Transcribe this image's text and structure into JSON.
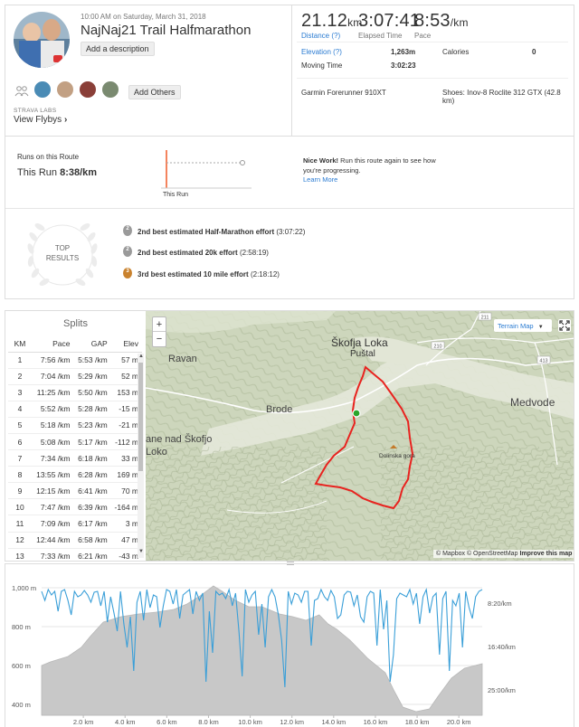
{
  "activity": {
    "datetime": "10:00 AM on Saturday, March 31, 2018",
    "title": "NajNaj21 Trail Halfmarathon",
    "add_description": "Add a description",
    "add_others": "Add Others",
    "strava_labs": "STRAVA LABS",
    "view_flybys": "View Flybys"
  },
  "stats": {
    "distance_value": "21.12",
    "distance_unit": "km",
    "distance_label": "Distance (?)",
    "elapsed_value": "3:07:41",
    "elapsed_label": "Elapsed Time",
    "pace_value": "8:53",
    "pace_unit": "/km",
    "pace_label": "Pace",
    "elevation_label": "Elevation (?)",
    "elevation_value": "1,263m",
    "calories_label": "Calories",
    "calories_value": "0",
    "moving_label": "Moving Time",
    "moving_value": "3:02:23",
    "device": "Garmin Forerunner 910XT",
    "shoes": "Shoes: Inov-8 Roclite 312 GTX (42.8 km)"
  },
  "route": {
    "heading": "Runs on this Route",
    "this_run_label": "This Run",
    "this_run_pace": "8:38/km",
    "chart_label": "This Run",
    "nice_work_bold": "Nice Work!",
    "nice_work_text": " Run this route again to see how you're progressing.",
    "learn_more": "Learn More"
  },
  "top_results": {
    "badge_line1": "TOP",
    "badge_line2": "RESULTS",
    "items": [
      {
        "rank": "2",
        "bold": "2nd best estimated Half-Marathon effort",
        "time": "(3:07:22)",
        "medal": "silver"
      },
      {
        "rank": "2",
        "bold": "2nd best estimated 20k effort",
        "time": "(2:58:19)",
        "medal": "silver"
      },
      {
        "rank": "3",
        "bold": "3rd best estimated 10 mile effort",
        "time": "(2:18:12)",
        "medal": "bronze"
      }
    ]
  },
  "splits": {
    "title": "Splits",
    "headers": [
      "KM",
      "Pace",
      "GAP",
      "Elev"
    ],
    "rows": [
      [
        "1",
        "7:56 /km",
        "5:53 /km",
        "57 m"
      ],
      [
        "2",
        "7:04 /km",
        "5:29 /km",
        "52 m"
      ],
      [
        "3",
        "11:25 /km",
        "5:50 /km",
        "153 m"
      ],
      [
        "4",
        "5:52 /km",
        "5:28 /km",
        "-15 m"
      ],
      [
        "5",
        "5:18 /km",
        "5:23 /km",
        "-21 m"
      ],
      [
        "6",
        "5:08 /km",
        "5:17 /km",
        "-112 m"
      ],
      [
        "7",
        "7:34 /km",
        "6:18 /km",
        "33 m"
      ],
      [
        "8",
        "13:55 /km",
        "6:28 /km",
        "169 m"
      ],
      [
        "9",
        "12:15 /km",
        "6:41 /km",
        "70 m"
      ],
      [
        "10",
        "7:47 /km",
        "6:39 /km",
        "-164 m"
      ],
      [
        "11",
        "7:09 /km",
        "6:17 /km",
        "3 m"
      ],
      [
        "12",
        "12:44 /km",
        "6:58 /km",
        "47 m"
      ],
      [
        "13",
        "7:33 /km",
        "6:21 /km",
        "-43 m"
      ]
    ]
  },
  "map": {
    "zoom_in": "+",
    "zoom_out": "−",
    "terrain_button": "Terrain Map",
    "attribution": "© Mapbox © OpenStreetMap",
    "improve": "Improve this map",
    "places": [
      "Ravan",
      "Škofja Loka",
      "Puštal",
      "Brode",
      "Medvode",
      "ane nad Škofjo",
      "Loko",
      "Dolinska gora"
    ],
    "road_labels": [
      "211",
      "210",
      "413"
    ],
    "colors": {
      "terrain": "#cfd8be",
      "route": "#e8231f",
      "start": "#2aa52a"
    }
  },
  "elevation_chart": {
    "left_axis": [
      "1,000 m",
      "800 m",
      "600 m",
      "400 m"
    ],
    "right_axis": [
      "8:20/km",
      "16:40/km",
      "25:00/km"
    ],
    "x_axis": [
      "2.0 km",
      "4.0 km",
      "6.0 km",
      "8.0 km",
      "10.0 km",
      "12.0 km",
      "14.0 km",
      "16.0 km",
      "18.0 km",
      "20.0 km"
    ],
    "colors": {
      "elevation": "#c8c8c8",
      "pace": "#3a9fd8"
    }
  }
}
